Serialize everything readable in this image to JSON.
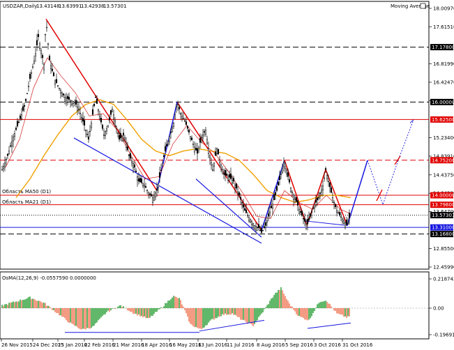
{
  "window": {
    "symbol_header": "USDZAR,Daily",
    "ohlc": [
      "13.43148",
      "13.63991",
      "13.42938",
      "13.57301"
    ],
    "indicator_label": "Moving Average"
  },
  "annotations": {
    "ma50_label": "Область MA50 (D1)",
    "ma21_label": "Область MA21 (D1)"
  },
  "colors": {
    "red": "#e00000",
    "blue": "#1515e0",
    "orange": "#f0a000",
    "candle": "#000000",
    "osma_up": "#1e9a2a",
    "osma_down": "#f07050"
  },
  "chart_data": [
    {
      "type": "line",
      "title": "USDZAR,Daily",
      "ylim": [
        12.25,
        18.2
      ],
      "y_ticks": [
        "18.00970",
        "17.61510",
        "16.81990",
        "16.42470",
        "16.02950",
        "15.23400",
        "14.83910",
        "14.43750",
        "14.04200",
        "13.64700",
        "12.85500",
        "12.45990"
      ],
      "x_ticks": [
        "26 Nov 2015",
        "24 Dec 2015",
        "25 Jan 2016",
        "22 Feb 2016",
        "21 Mar 2016",
        "18 Apr 2016",
        "16 May 2016",
        "13 Jun 2016",
        "11 Jul 2016",
        "8 Aug 2016",
        "5 Sep 2016",
        "3 Oct 2016",
        "31 Oct 2016"
      ],
      "price_path": [
        [
          0,
          14.55
        ],
        [
          8,
          14.85
        ],
        [
          16,
          15.25
        ],
        [
          25,
          15.6
        ],
        [
          33,
          15.95
        ],
        [
          40,
          16.5
        ],
        [
          47,
          16.95
        ],
        [
          52,
          17.4
        ],
        [
          56,
          17.1
        ],
        [
          60,
          16.8
        ],
        [
          63,
          17.78
        ],
        [
          68,
          16.9
        ],
        [
          75,
          16.5
        ],
        [
          82,
          16.3
        ],
        [
          90,
          16.1
        ],
        [
          97,
          16.05
        ],
        [
          104,
          16.0
        ],
        [
          110,
          15.85
        ],
        [
          118,
          15.5
        ],
        [
          124,
          15.2
        ],
        [
          128,
          15.55
        ],
        [
          134,
          16.1
        ],
        [
          140,
          15.7
        ],
        [
          146,
          15.3
        ],
        [
          152,
          15.5
        ],
        [
          158,
          15.85
        ],
        [
          162,
          15.6
        ],
        [
          168,
          15.2
        ],
        [
          175,
          15.3
        ],
        [
          182,
          14.85
        ],
        [
          189,
          14.65
        ],
        [
          196,
          14.3
        ],
        [
          203,
          14.25
        ],
        [
          210,
          14.05
        ],
        [
          216,
          13.95
        ],
        [
          222,
          14.1
        ],
        [
          227,
          14.45
        ],
        [
          233,
          14.9
        ],
        [
          240,
          15.25
        ],
        [
          246,
          15.55
        ],
        [
          251,
          16.0
        ],
        [
          256,
          15.75
        ],
        [
          262,
          15.6
        ],
        [
          268,
          15.35
        ],
        [
          274,
          15.1
        ],
        [
          280,
          14.9
        ],
        [
          286,
          15.25
        ],
        [
          292,
          15.4
        ],
        [
          296,
          15.0
        ],
        [
          302,
          14.55
        ],
        [
          308,
          15.0
        ],
        [
          313,
          14.7
        ],
        [
          318,
          14.45
        ],
        [
          325,
          14.4
        ],
        [
          332,
          14.3
        ],
        [
          340,
          14.0
        ],
        [
          347,
          13.7
        ],
        [
          355,
          13.5
        ],
        [
          362,
          13.35
        ],
        [
          368,
          13.3
        ],
        [
          372,
          13.2
        ],
        [
          378,
          13.35
        ],
        [
          383,
          13.6
        ],
        [
          389,
          13.85
        ],
        [
          394,
          14.1
        ],
        [
          400,
          14.45
        ],
        [
          405,
          14.75
        ],
        [
          410,
          14.4
        ],
        [
          415,
          14.1
        ],
        [
          420,
          13.95
        ],
        [
          426,
          13.7
        ],
        [
          432,
          13.5
        ],
        [
          437,
          13.35
        ],
        [
          442,
          13.55
        ],
        [
          448,
          13.8
        ],
        [
          454,
          13.95
        ],
        [
          460,
          14.2
        ],
        [
          464,
          14.55
        ],
        [
          468,
          14.3
        ],
        [
          473,
          14.0
        ],
        [
          479,
          13.7
        ],
        [
          485,
          13.55
        ],
        [
          490,
          13.45
        ],
        [
          495,
          13.35
        ],
        [
          499,
          13.57
        ]
      ],
      "series": [
        {
          "name": "Moving Average",
          "color": "#f0a000"
        }
      ],
      "horizontal_levels": [
        {
          "label": "17.17800",
          "value": 17.178,
          "style": "dashed",
          "color": "#000000"
        },
        {
          "label": "16.00000",
          "value": 16.0,
          "style": "dashed",
          "color": "#000000"
        },
        {
          "label": "15.62500",
          "value": 15.625,
          "style": "solid",
          "color": "#e00000"
        },
        {
          "label": "14.75200",
          "value": 14.752,
          "style": "dashed",
          "color": "#e00000"
        },
        {
          "label": "14.00000",
          "value": 14.0,
          "style": "solid",
          "color": "#e00000"
        },
        {
          "label": "13.79600",
          "value": 13.796,
          "style": "solid",
          "color": "#e00000"
        },
        {
          "label": "13.57301",
          "value": 13.57301,
          "style": "dotted",
          "color": "#000000"
        },
        {
          "label": "13.31000",
          "value": 13.31,
          "style": "solid",
          "color": "#1515e0"
        },
        {
          "label": "13.16800",
          "value": 13.168,
          "style": "dashed",
          "color": "#000000"
        }
      ]
    },
    {
      "type": "bar",
      "title": "OsMA(12,26,9) -0.0557590 0.0000000",
      "ylim": [
        -0.2,
        0.22
      ],
      "y_ticks": [
        "0.218742",
        "0.00",
        "-0.1969103"
      ]
    }
  ]
}
